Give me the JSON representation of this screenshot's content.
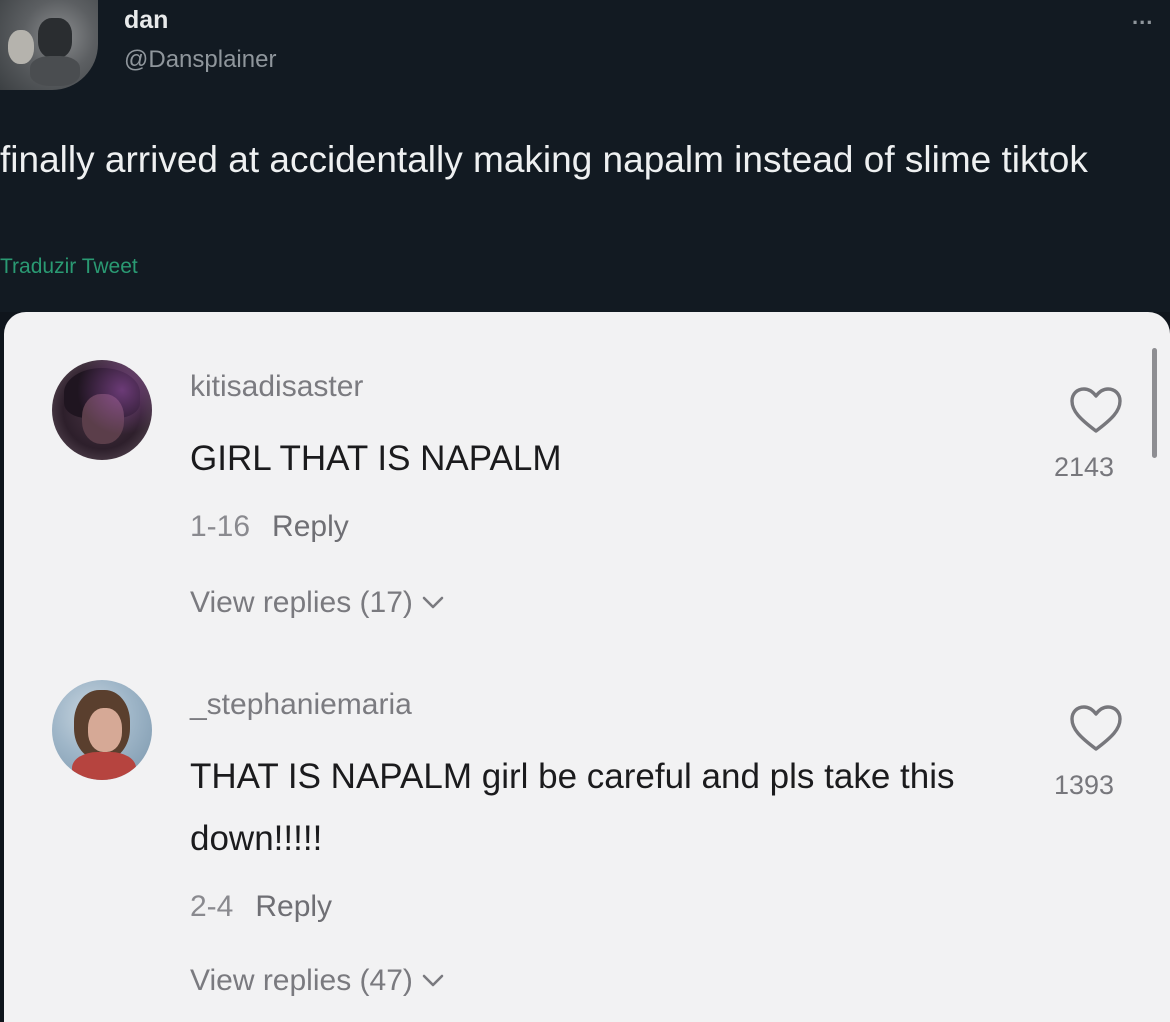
{
  "tweet": {
    "name": "dan",
    "handle": "@Dansplainer",
    "more": "...",
    "text": "finally arrived at accidentally making napalm instead of slime tiktok",
    "translate": "Traduzir Tweet"
  },
  "comments": [
    {
      "username": "kitisadisaster",
      "text": "GIRL THAT IS NAPALM",
      "date": "1-16",
      "reply": "Reply",
      "view_replies": "View replies (17)",
      "likes": "2143"
    },
    {
      "username": "_stephaniemaria",
      "text": "THAT IS NAPALM girl be careful and pls take this down!!!!!",
      "date": "2-4",
      "reply": "Reply",
      "view_replies": "View replies (47)",
      "likes": "1393"
    }
  ],
  "icons": [
    "heart-icon",
    "chevron-down-icon",
    "more-options-icon"
  ],
  "colors": {
    "tweet_bg": "#121a22",
    "panel_bg": "#f2f2f3",
    "translate": "#2a9a73"
  }
}
